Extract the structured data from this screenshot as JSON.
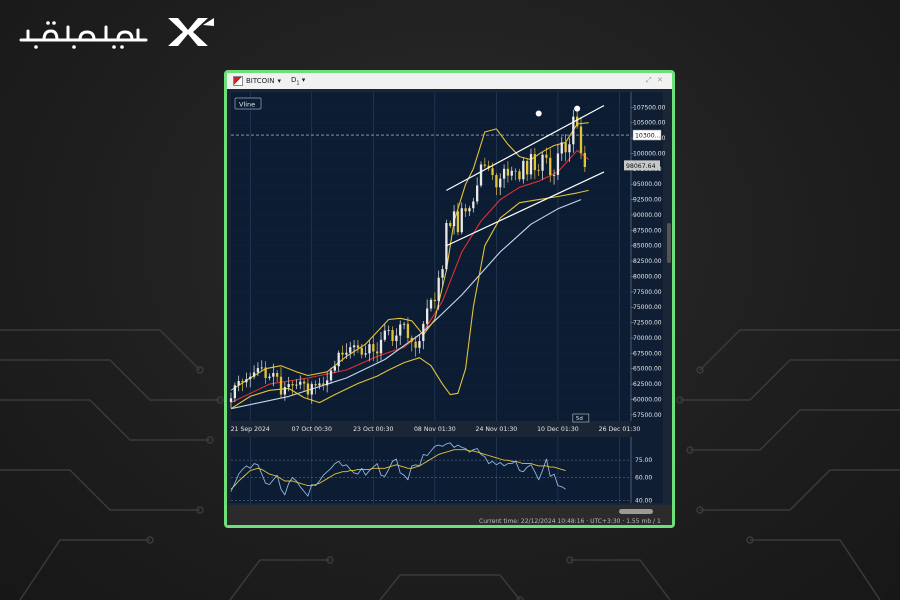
{
  "brand": {
    "logo_text": "تیوبیت",
    "frame_color": "#6ee07a"
  },
  "window": {
    "symbol": "BITCOIN",
    "symbol_caret": "▾",
    "timeframe": "D",
    "timeframe_sub": "1",
    "timeframe_caret": "▾",
    "vline_button": "Vline",
    "status_text": "Current time: 22/12/2024 10:48:16 · UTC+3:30 · 1.55 mb / 1"
  },
  "chart_data": {
    "type": "candlestick",
    "price_axis": {
      "ylim": [
        56500,
        110000
      ],
      "ticks": [
        107500,
        105000,
        102500,
        100000,
        97500,
        95000,
        92500,
        90000,
        87500,
        85000,
        82500,
        80000,
        77500,
        75000,
        72500,
        70000,
        67500,
        65000,
        62500,
        60000,
        57500
      ],
      "tick_labels": [
        "107500.00",
        "105000.00",
        "102500.00",
        "100000.00",
        "97500.00",
        "95000.00",
        "92500.00",
        "90000.00",
        "87500.00",
        "85000.00",
        "82500.00",
        "80000.00",
        "77500.00",
        "75000.00",
        "72500.00",
        "70000.00",
        "67500.00",
        "65000.00",
        "62500.00",
        "60000.00",
        "57500.00"
      ],
      "marked_levels": [
        {
          "label": "10300...",
          "value": 103000,
          "style": "dashed"
        },
        {
          "label": "98067.64",
          "value": 98068,
          "style": "current-price"
        }
      ]
    },
    "time_axis": {
      "labels": [
        "21 Sep 2024",
        "07 Oct 00:30",
        "23 Oct 00:30",
        "08 Nov 01:30",
        "24 Nov 01:30",
        "10 Dec 01:30",
        "26 Dec 01:30"
      ],
      "label_bar_index": [
        5,
        21,
        37,
        53,
        69,
        85,
        101
      ],
      "xlim_bars": [
        0,
        104
      ],
      "bar_count": 93,
      "marker_label": "5d"
    },
    "close": [
      60200,
      62300,
      63000,
      62800,
      63300,
      63700,
      64400,
      65100,
      65200,
      63500,
      63700,
      64300,
      63700,
      60800,
      62000,
      62500,
      62300,
      62400,
      62900,
      62600,
      60800,
      62500,
      62300,
      62600,
      62300,
      63100,
      64700,
      65400,
      67600,
      67300,
      67600,
      68500,
      68800,
      68400,
      67300,
      67500,
      69000,
      67800,
      67500,
      69700,
      71200,
      71300,
      69500,
      70400,
      72200,
      72300,
      70000,
      69400,
      68400,
      69500,
      72300,
      74800,
      76200,
      76000,
      79800,
      81200,
      88700,
      88200,
      90600,
      87200,
      91100,
      90600,
      91100,
      92200,
      94800,
      98200,
      98000,
      97600,
      96500,
      94500,
      95900,
      97500,
      96400,
      97200,
      97100,
      95800,
      98800,
      96600,
      99900,
      97300,
      97200,
      99800,
      99300,
      96500,
      96500,
      100000,
      101800,
      100200,
      101500,
      106000,
      104400,
      100100,
      97800
    ],
    "series": [
      {
        "name": "",
        "type": "moving-average",
        "color": "#e03030",
        "points": [
          [
            0,
            59500
          ],
          [
            10,
            62500
          ],
          [
            20,
            63500
          ],
          [
            30,
            64800
          ],
          [
            38,
            67000
          ],
          [
            45,
            68500
          ],
          [
            50,
            71000
          ],
          [
            55,
            76000
          ],
          [
            60,
            84000
          ],
          [
            65,
            89000
          ],
          [
            70,
            92500
          ],
          [
            75,
            94500
          ],
          [
            80,
            95500
          ],
          [
            85,
            97000
          ],
          [
            90,
            100500
          ],
          [
            93,
            99000
          ]
        ]
      },
      {
        "name": "",
        "type": "moving-average",
        "color": "#c7d7ee",
        "points": [
          [
            0,
            58500
          ],
          [
            15,
            60500
          ],
          [
            30,
            63500
          ],
          [
            40,
            66500
          ],
          [
            50,
            71000
          ],
          [
            60,
            77000
          ],
          [
            70,
            84000
          ],
          [
            78,
            88500
          ],
          [
            85,
            91000
          ],
          [
            91,
            92500
          ]
        ]
      },
      {
        "name": "",
        "type": "bollinger-upper",
        "color": "#e4c23a",
        "points": [
          [
            0,
            61500
          ],
          [
            5,
            63500
          ],
          [
            9,
            65000
          ],
          [
            13,
            65500
          ],
          [
            17,
            64500
          ],
          [
            20,
            63900
          ],
          [
            25,
            64500
          ],
          [
            30,
            67000
          ],
          [
            35,
            69000
          ],
          [
            38,
            71000
          ],
          [
            41,
            73000
          ],
          [
            44,
            73200
          ],
          [
            47,
            72800
          ],
          [
            50,
            70500
          ],
          [
            53,
            73000
          ],
          [
            56,
            81000
          ],
          [
            58,
            89000
          ],
          [
            61,
            95000
          ],
          [
            63,
            97500
          ],
          [
            66,
            103500
          ],
          [
            69,
            104000
          ],
          [
            72,
            101500
          ],
          [
            75,
            99500
          ],
          [
            78,
            99000
          ],
          [
            81,
            100300
          ],
          [
            84,
            101300
          ],
          [
            87,
            101800
          ],
          [
            90,
            104800
          ],
          [
            93,
            105000
          ]
        ]
      },
      {
        "name": "",
        "type": "bollinger-lower",
        "color": "#e4c23a",
        "points": [
          [
            0,
            58500
          ],
          [
            5,
            60500
          ],
          [
            10,
            61500
          ],
          [
            15,
            61800
          ],
          [
            19,
            60300
          ],
          [
            23,
            59500
          ],
          [
            27,
            60800
          ],
          [
            33,
            62600
          ],
          [
            38,
            63800
          ],
          [
            41,
            64800
          ],
          [
            45,
            66000
          ],
          [
            49,
            66800
          ],
          [
            52,
            65500
          ],
          [
            55,
            62500
          ],
          [
            57,
            60800
          ],
          [
            59,
            61000
          ],
          [
            61,
            65000
          ],
          [
            63,
            75000
          ],
          [
            66,
            85000
          ],
          [
            70,
            89500
          ],
          [
            75,
            92000
          ],
          [
            80,
            92500
          ],
          [
            85,
            93000
          ],
          [
            90,
            93600
          ],
          [
            93,
            94000
          ]
        ]
      }
    ],
    "channel_lines": [
      {
        "points": [
          [
            56,
            94000
          ],
          [
            97,
            107800
          ]
        ]
      },
      {
        "points": [
          [
            56,
            85000
          ],
          [
            97,
            97000
          ]
        ]
      }
    ],
    "markers": [
      {
        "type": "dot",
        "x": 80,
        "y": 106500
      },
      {
        "type": "dot",
        "x": 90,
        "y": 107300
      }
    ],
    "oscillator": {
      "ylim": [
        38,
        95
      ],
      "ticks": [
        75,
        60,
        40
      ],
      "tick_labels": [
        "75.00",
        "60.00",
        "40.00"
      ],
      "series": [
        {
          "name": "",
          "color": "#8fb5e0",
          "values": [
            48,
            55,
            63,
            67,
            70,
            68,
            72,
            71,
            63,
            55,
            54,
            58,
            62,
            50,
            45,
            55,
            60,
            57,
            52,
            48,
            44,
            54,
            53,
            57,
            62,
            65,
            68,
            72,
            74,
            70,
            71,
            67,
            64,
            63,
            68,
            62,
            66,
            69,
            72,
            62,
            61,
            67,
            74,
            76,
            64,
            62,
            58,
            70,
            71,
            70,
            80,
            79,
            83,
            87,
            88,
            87,
            89,
            90,
            86,
            88,
            86,
            85,
            82,
            84,
            85,
            80,
            78,
            72,
            74,
            71,
            73,
            70,
            72,
            72,
            74,
            66,
            65,
            69,
            71,
            65,
            58,
            66,
            76,
            61,
            63,
            53,
            52,
            50
          ]
        },
        {
          "name": "",
          "color": "#e4c23a",
          "values": [
            50,
            53,
            57,
            60,
            63,
            66,
            67,
            68,
            67,
            65,
            63,
            62,
            61,
            59,
            57,
            57,
            57,
            56,
            55,
            54,
            53,
            53,
            54,
            55,
            57,
            59,
            61,
            63,
            64,
            65,
            65,
            66,
            66,
            67,
            67,
            67,
            67,
            68,
            68,
            68,
            68,
            69,
            70,
            71,
            70,
            69,
            68,
            68,
            69,
            70,
            72,
            74,
            76,
            78,
            80,
            81,
            82,
            83,
            84,
            84,
            84,
            84,
            83,
            83,
            82,
            81,
            80,
            79,
            78,
            77,
            76,
            75,
            75,
            74,
            74,
            73,
            72,
            72,
            72,
            71,
            70,
            70,
            70,
            69,
            69,
            68,
            67,
            66
          ]
        }
      ]
    },
    "colors": {
      "background": "#0b1c33",
      "grid": "#2d4160",
      "candle_up": "#e9e9e9",
      "candle_down": "#e4c23a",
      "axis_text": "#e6e6e6",
      "channel": "#ffffff"
    }
  }
}
